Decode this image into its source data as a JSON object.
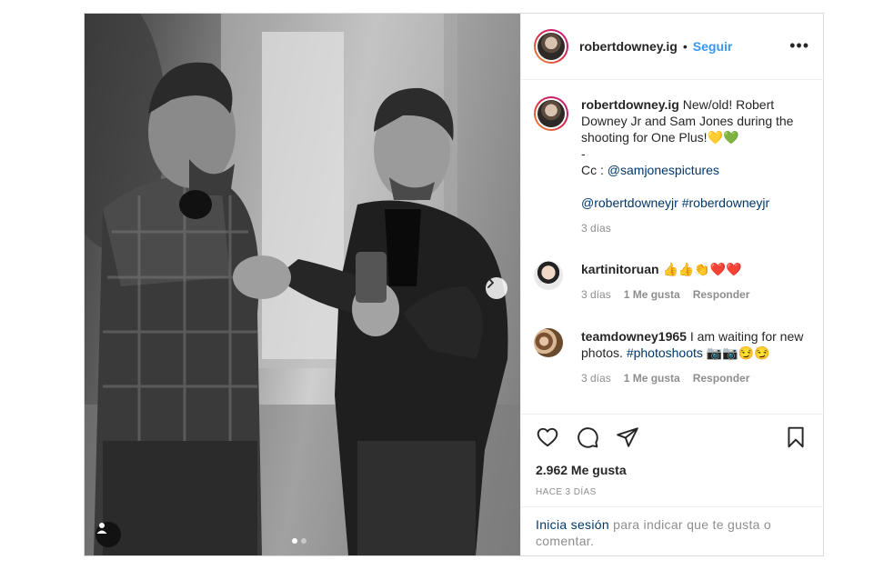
{
  "post": {
    "username": "robertdowney.ig",
    "bullet": "•",
    "follow_label": "Seguir",
    "more_label": "•••",
    "caption": {
      "username": "robertdowney.ig",
      "line1": "New/old! Robert Downey Jr and Sam Jones during the shooting for One Plus!💛💚",
      "line2": "-",
      "line3_prefix": "Cc : ",
      "line3_mention": "@samjonespictures",
      "line4_mention": "@robertdowneyjr",
      "line4_tag": "#roberdowneyjr",
      "time": "3 días"
    },
    "comments": [
      {
        "username": "kartinitoruan",
        "text": "👍👍👏❤️❤️",
        "time": "3 días",
        "likes": "1 Me gusta",
        "reply": "Responder"
      },
      {
        "username": "teamdowney1965",
        "text_prefix": "I am waiting for new photos. ",
        "tag": "#photoshoots",
        "text_suffix": " 📷📷😏😏",
        "time": "3 días",
        "likes": "1 Me gusta",
        "reply": "Responder"
      }
    ],
    "likes_count": "2.962 Me gusta",
    "age": "HACE 3 DÍAS",
    "login_link": "Inicia sesión",
    "login_text": " para indicar que te gusta o comentar."
  },
  "icons": {
    "like": "heart-icon",
    "comment": "comment-icon",
    "share": "paper-plane-icon",
    "save": "bookmark-icon",
    "next": "chevron-right-icon",
    "tags": "user-icon"
  },
  "colors": {
    "accent": "#3897f0",
    "link": "#00376b",
    "muted": "#8e8e8e",
    "border": "#dbdbdb"
  },
  "carousel": {
    "slides": 2,
    "active": 1
  }
}
